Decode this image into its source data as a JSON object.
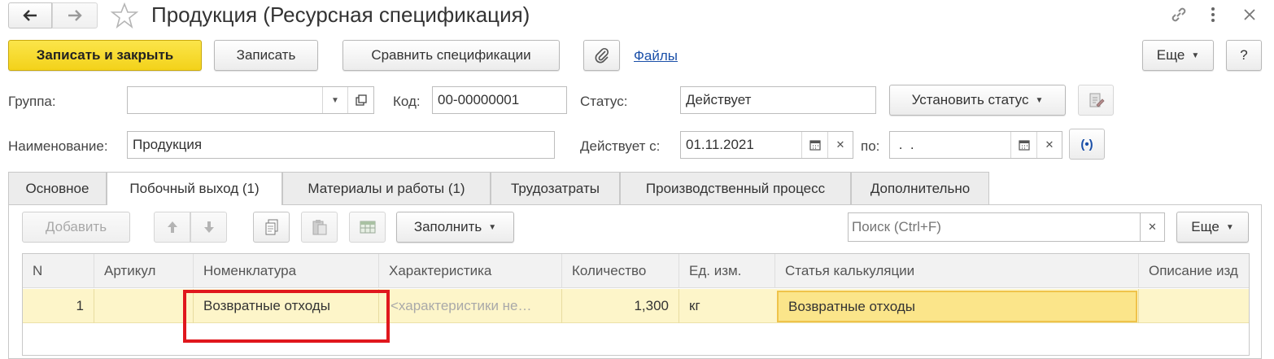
{
  "window": {
    "title": "Продукция (Ресурсная спецификация)"
  },
  "toolbar": {
    "save_close": "Записать и закрыть",
    "save": "Записать",
    "compare": "Сравнить спецификации",
    "files_link": "Файлы",
    "more": "Еще",
    "help": "?"
  },
  "form": {
    "group_label": "Группа:",
    "group_value": "",
    "code_label": "Код:",
    "code_value": "00-00000001",
    "status_label": "Статус:",
    "status_value": "Действует",
    "set_status": "Установить статус",
    "name_label": "Наименование:",
    "name_value": "Продукция",
    "valid_from_label": "Действует с:",
    "valid_from_value": "01.11.2021",
    "to_label": "по:",
    "to_value": " .  ."
  },
  "tabs": [
    {
      "label": "Основное"
    },
    {
      "label": "Побочный выход (1)"
    },
    {
      "label": "Материалы и работы (1)"
    },
    {
      "label": "Трудозатраты"
    },
    {
      "label": "Производственный процесс"
    },
    {
      "label": "Дополнительно"
    }
  ],
  "table_toolbar": {
    "add": "Добавить",
    "fill": "Заполнить",
    "search_placeholder": "Поиск (Ctrl+F)",
    "more": "Еще"
  },
  "table": {
    "headers": [
      "N",
      "Артикул",
      "Номенклатура",
      "Характеристика",
      "Количество",
      "Ед. изм.",
      "Статья калькуляции",
      "Описание изд"
    ],
    "rows": [
      {
        "n": "1",
        "article": "",
        "nomenclature": "Возвратные отходы",
        "characteristic": "<характеристики не…",
        "quantity": "1,300",
        "unit": "кг",
        "cost_item": "Возвратные отходы",
        "description": ""
      }
    ]
  },
  "colors": {
    "primary_button": "#f3d21a",
    "selected_row": "#fdf5c9",
    "highlight_frame": "#e0171d",
    "link": "#1a4fa8"
  }
}
